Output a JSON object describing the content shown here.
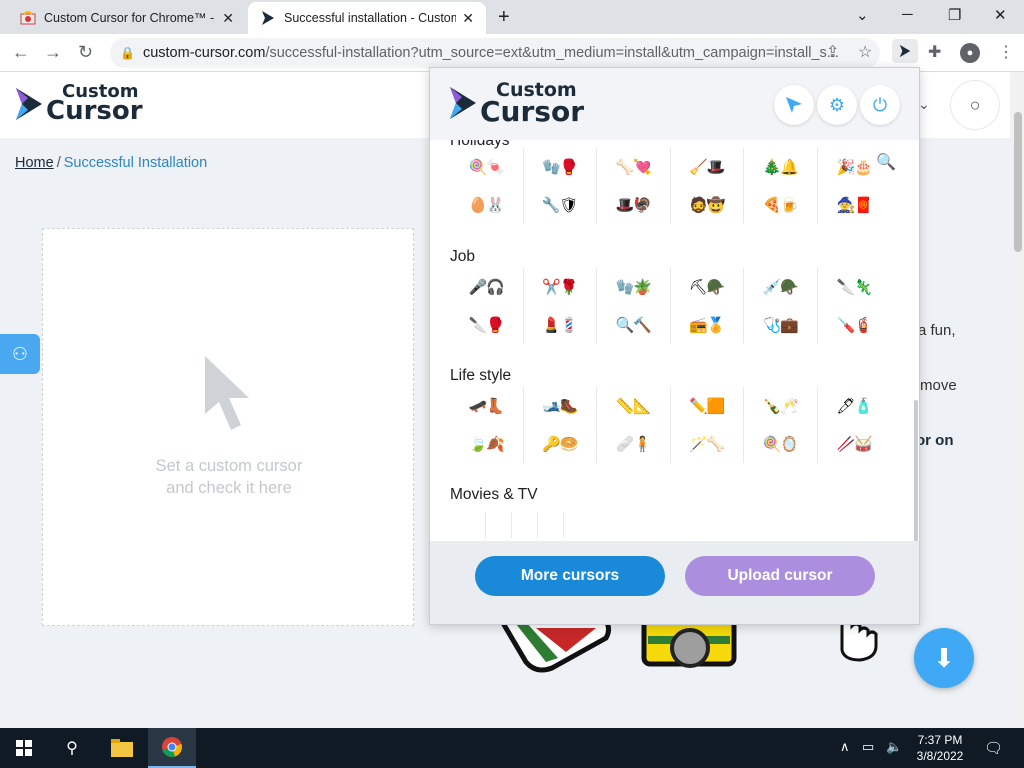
{
  "browser": {
    "tabs": [
      {
        "title": "Custom Cursor for Chrome™ - Ch",
        "close": "✕"
      },
      {
        "title": "Successful installation - Custom C",
        "close": "✕"
      }
    ],
    "new_tab": "+",
    "window_controls": {
      "minimize": "─",
      "maximize": "❐",
      "close": "✕",
      "tab_search": "⌄"
    },
    "url_host": "custom-cursor.com",
    "url_path": "/successful-installation?utm_source=ext&utm_medium=install&utm_campaign=install_s..."
  },
  "site": {
    "logo_top": "Custom",
    "logo_bottom": "Cursor",
    "breadcrumb": {
      "home": "Home",
      "separator": "/",
      "current": "Successful Installation"
    },
    "preview_text_1": "Set a custom cursor",
    "preview_text_2": "and check it here",
    "right_text": [
      "a fun,",
      "move",
      "or on"
    ]
  },
  "popup": {
    "logo_top": "Custom",
    "logo_bottom": "Cursor",
    "categories": [
      {
        "name": "Holidays",
        "rows": [
          [
            "🍭🍬",
            "🧤🥊",
            "🦴💘",
            "🧹🎩",
            "🎄🔔",
            "🎉🎂"
          ],
          [
            "🥚🐰",
            "🔧🛡",
            "🎩🦃",
            "🧔🤠",
            "🍕🍺",
            "🧙🧧"
          ]
        ]
      },
      {
        "name": "Job",
        "rows": [
          [
            "🎤🎧",
            "✂️🌹",
            "🧤🪴",
            "⛏🪖",
            "💉🪖",
            "🔪🦎"
          ],
          [
            "🔪🥊",
            "💄💈",
            "🔍🔨",
            "📻🏅",
            "🩺💼",
            "🪛🧯"
          ]
        ]
      },
      {
        "name": "Life style",
        "rows": [
          [
            "🛹👢",
            "🎿🥾",
            "📏📐",
            "✏️🟧",
            "🍾🥂",
            "🖊🧴"
          ],
          [
            "🍃🍂",
            "🔑🥯",
            "🩹🧍",
            "🪄🦴",
            "🍭🪞",
            "🥢🥁"
          ]
        ]
      },
      {
        "name": "Movies & TV",
        "rows": []
      }
    ],
    "more_button": "More cursors",
    "upload_button": "Upload cursor"
  },
  "taskbar": {
    "time": "7:37 PM",
    "date": "3/8/2022"
  },
  "colors": {
    "accent_blue": "#1a8ad8",
    "upload_purple": "#ab8fde",
    "link_blue": "#2e86c1",
    "taskbar": "#0f1a24"
  }
}
